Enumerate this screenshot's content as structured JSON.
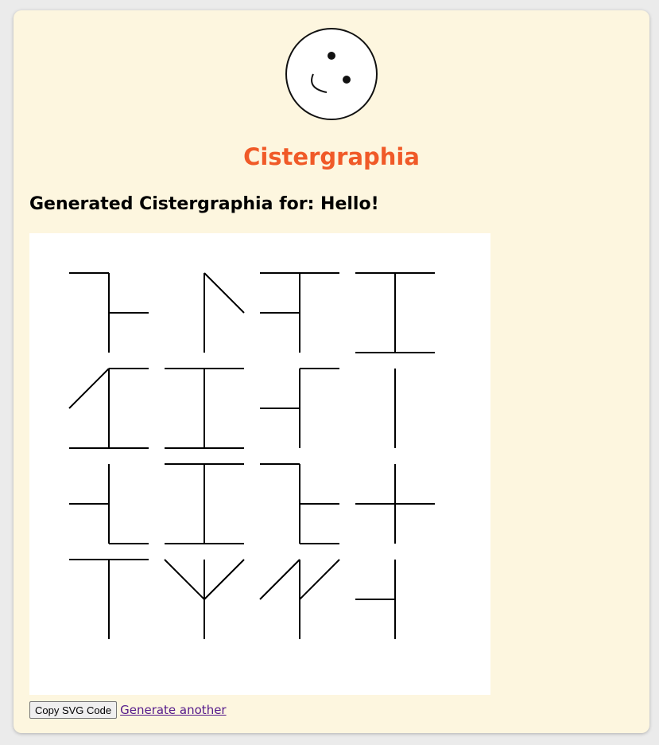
{
  "header": {
    "logo_icon": "smiley-face-icon",
    "app_title": "Cistergraphia"
  },
  "result": {
    "heading": "Generated Cistergraphia for: Hello!",
    "glyph_rows": 4,
    "glyph_cols": 4
  },
  "actions": {
    "copy_label": "Copy SVG Code",
    "generate_label": "Generate another"
  },
  "colors": {
    "title": "#f05a28",
    "card_background": "#fdf6df",
    "link": "#551a8b"
  }
}
